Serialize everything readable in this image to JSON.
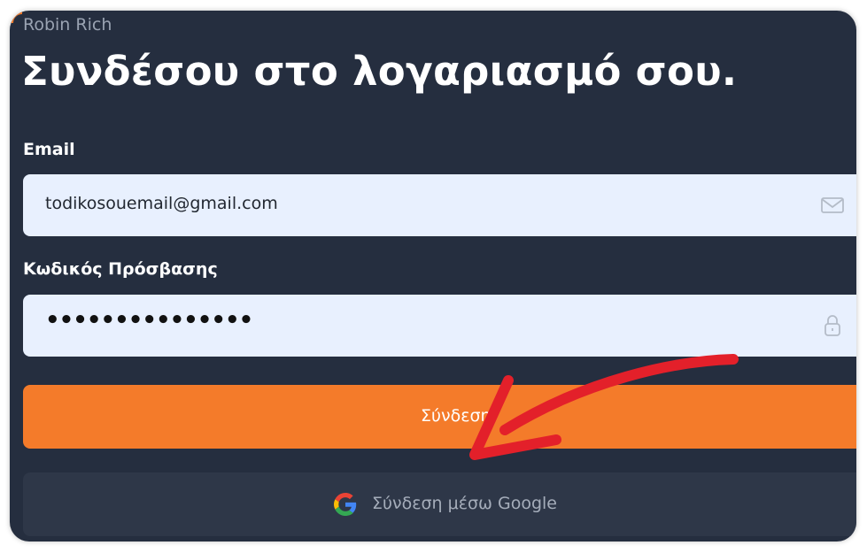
{
  "brand": "Robin Rich",
  "title": "Συνδέσου στο λογαριασμό σου.",
  "email": {
    "label": "Email",
    "value": "todikosouemail@gmail.com",
    "icon": "envelope-icon"
  },
  "password": {
    "label": "Κωδικός Πρόσβασης",
    "value": "•••••••••••••••",
    "icon": "lock-icon"
  },
  "login_button": {
    "label": "Σύνδεση"
  },
  "google_button": {
    "label": "Σύνδεση μέσω Google",
    "icon": "google-icon"
  },
  "annotation": {
    "type": "arrow",
    "color": "#e3202a",
    "points_to": "login_button"
  },
  "colors": {
    "background": "#252e3f",
    "accent": "#f47b2a",
    "field": "#e8f0fe",
    "google_button": "#2e3748"
  }
}
